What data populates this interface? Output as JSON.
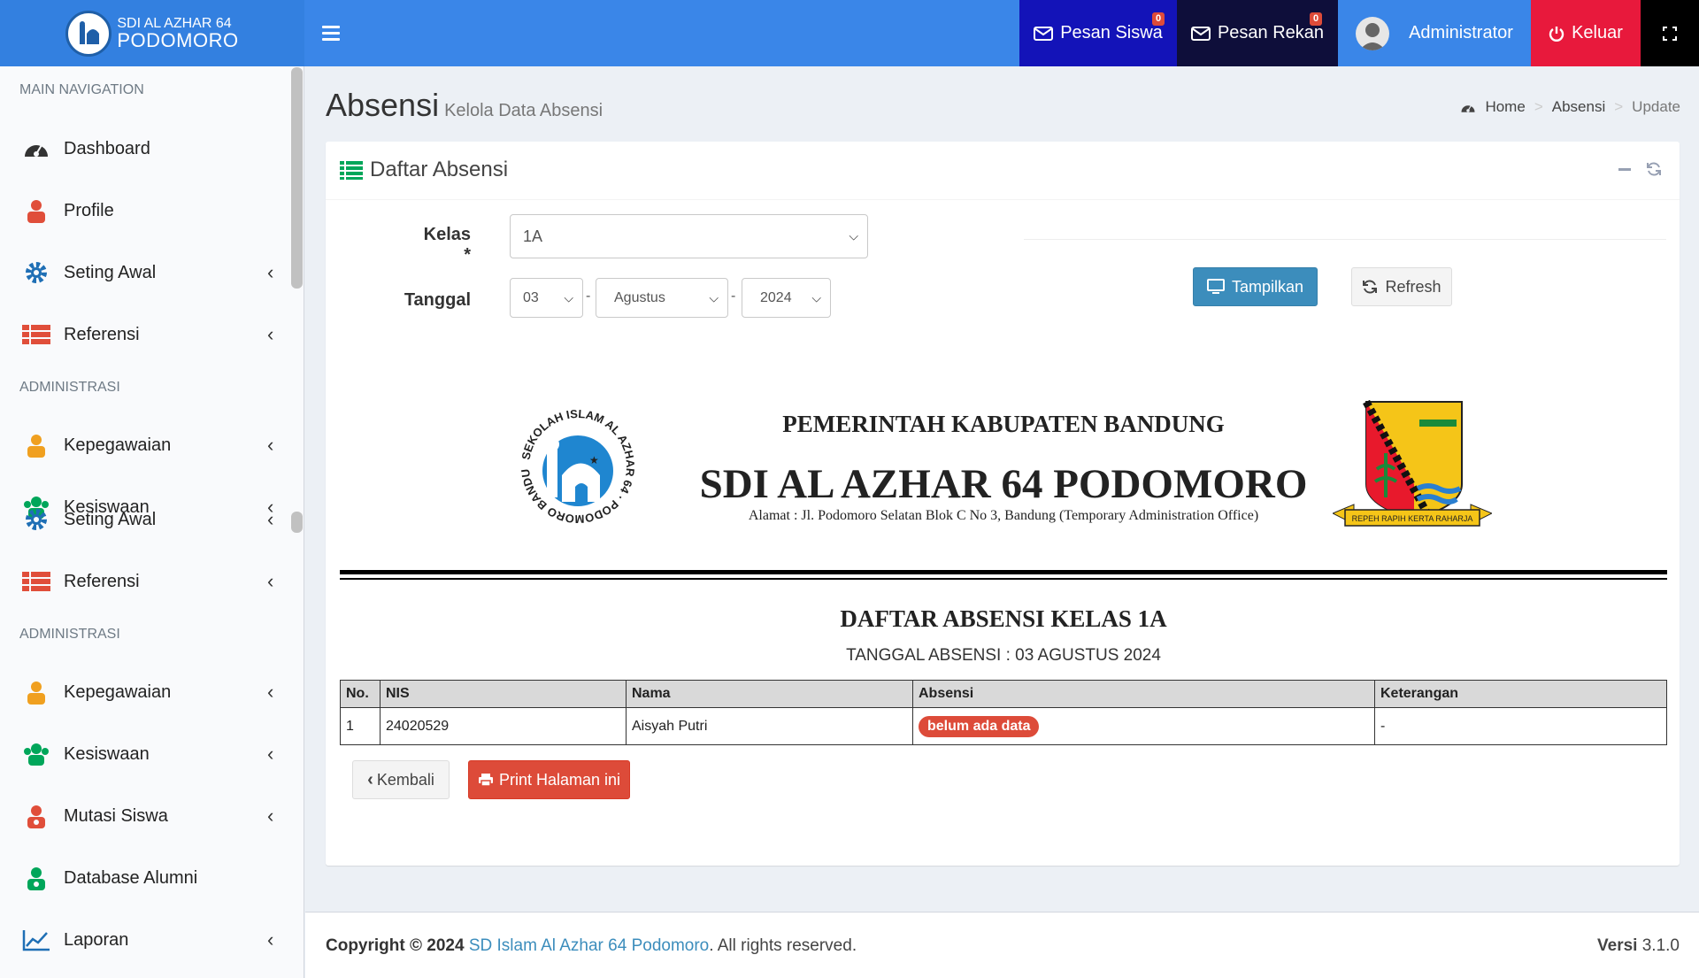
{
  "header": {
    "logo_line1": "SDI AL AZHAR 64",
    "logo_line2": "PODOMORO",
    "pesan_siswa": "Pesan Siswa",
    "pesan_siswa_count": "0",
    "pesan_rekan": "Pesan Rekan",
    "pesan_rekan_count": "0",
    "user": "Administrator",
    "logout": "Keluar"
  },
  "sidebar": {
    "headers": [
      "MAIN NAVIGATION",
      "ADMINISTRASI",
      "ADMINISTRASI"
    ],
    "items": [
      {
        "label": "Dashboard",
        "icon": "dashboard-icon"
      },
      {
        "label": "Profile",
        "icon": "profile-icon"
      },
      {
        "label": "Seting Awal",
        "icon": "gear-icon"
      },
      {
        "label": "Referensi",
        "icon": "list-icon"
      },
      {
        "label": "Kepegawaian",
        "icon": "staff-icon"
      },
      {
        "label": "Kesiswaan",
        "icon": "users-icon"
      },
      {
        "label": "Seting Awal",
        "icon": "gear-icon"
      },
      {
        "label": "Referensi",
        "icon": "list-icon"
      },
      {
        "label": "Kepegawaian",
        "icon": "staff-icon"
      },
      {
        "label": "Kesiswaan",
        "icon": "users-icon"
      },
      {
        "label": "Mutasi Siswa",
        "icon": "user-transfer-icon"
      },
      {
        "label": "Database Alumni",
        "icon": "alumni-icon"
      },
      {
        "label": "Laporan",
        "icon": "chart-icon"
      }
    ]
  },
  "page": {
    "title": "Absensi",
    "subtitle": "Kelola Data Absensi",
    "breadcrumb_home": "Home",
    "breadcrumb_section": "Absensi",
    "breadcrumb_current": "Update"
  },
  "box": {
    "title": "Daftar Absensi"
  },
  "form": {
    "kelas_label": "Kelas *",
    "kelas_value": "1A",
    "tanggal_label": "Tanggal",
    "day": "03",
    "month": "Agustus",
    "year": "2024",
    "tampilkan": "Tampilkan",
    "refresh": "Refresh"
  },
  "letterhead": {
    "line1": "PEMERINTAH KABUPATEN BANDUNG",
    "line2": "SDI AL AZHAR 64 PODOMORO",
    "address": "Alamat : Jl. Podomoro Selatan Blok C No 3, Bandung (Temporary Administration Office)",
    "logo_left_text": "SEKOLAH ISLAM AL AZHAR 64 · PODOMORO BANDUNG",
    "logo_right_ribbon": "REPEH RAPIH KERTA RAHARJA"
  },
  "report": {
    "title": "DAFTAR ABSENSI KELAS 1A",
    "subtitle": "TANGGAL ABSENSI : 03 AGUSTUS 2024",
    "columns": [
      "No.",
      "NIS",
      "Nama",
      "Absensi",
      "Keterangan"
    ],
    "rows": [
      {
        "no": "1",
        "nis": "24020529",
        "nama": "Aisyah Putri",
        "absensi": "belum ada data",
        "keterangan": "-"
      }
    ]
  },
  "actions": {
    "kembali": "Kembali",
    "print": "Print Halaman ini"
  },
  "footer": {
    "copyright": "Copyright © 2024",
    "org": "SD Islam Al Azhar 64 Podomoro",
    "rights": ". All rights reserved.",
    "versi_label": "Versi",
    "versi": "3.1.0"
  },
  "colors": {
    "header": "#3a86e8",
    "pesan_siswa": "#1313b8",
    "pesan_rekan": "#0e0e3a",
    "keluar": "#e8193c",
    "primary": "#3c8dbc",
    "danger": "#dd4b39"
  }
}
